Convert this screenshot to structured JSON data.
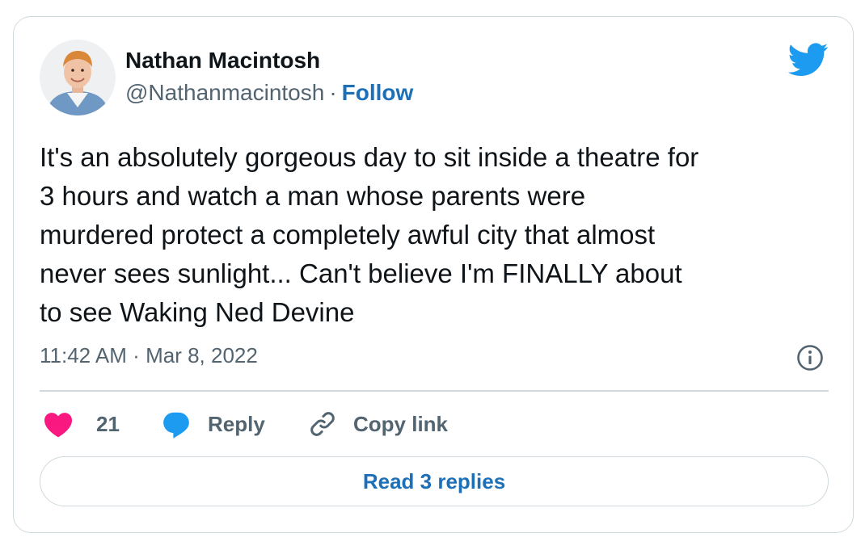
{
  "author": {
    "name": "Nathan Macintosh",
    "handle": "@Nathanmacintosh",
    "separator": "·",
    "follow_label": "Follow"
  },
  "tweet": {
    "text": "It's an absolutely gorgeous day to sit inside a theatre for\n3 hours and watch a man whose parents were\nmurdered protect a completely awful city that almost\nnever sees sunlight... Can't believe I'm FINALLY about\nto see Waking Ned Devine",
    "time": "11:42 AM",
    "separator": "·",
    "date": "Mar 8, 2022"
  },
  "actions": {
    "like_count": "21",
    "reply_label": "Reply",
    "copy_link_label": "Copy link",
    "read_replies_label": "Read 3 replies"
  },
  "icons": {
    "brand": "twitter-bird-icon",
    "info": "info-icon",
    "like": "heart-icon",
    "reply": "speech-bubble-icon",
    "copy": "link-icon"
  },
  "colors": {
    "twitter_blue": "#1d9bf0",
    "link_blue": "#1d70b8",
    "heart_pink": "#f91880",
    "text_primary": "#0f1419",
    "text_secondary": "#536471",
    "border": "#cfd9de"
  }
}
